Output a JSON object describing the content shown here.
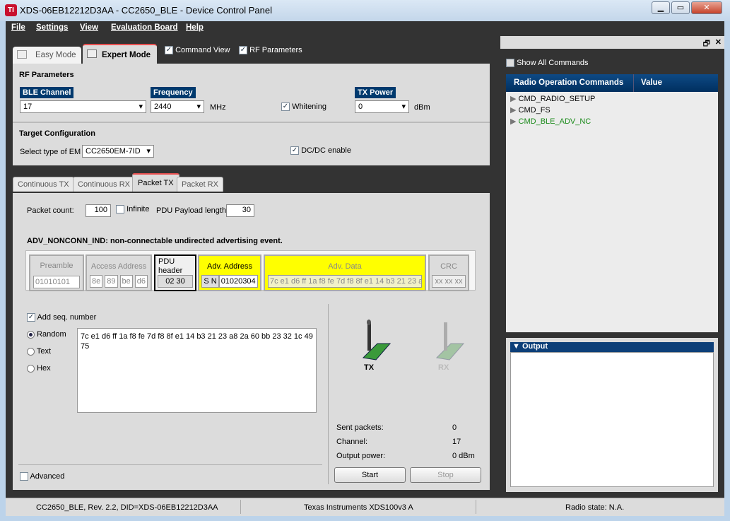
{
  "window": {
    "title": "XDS-06EB12212D3AA - CC2650_BLE - Device Control Panel",
    "logo": "TI",
    "min": "▁",
    "max": "▭",
    "close": "✕"
  },
  "menu": [
    "File",
    "Settings",
    "View",
    "Evaluation Board",
    "Help"
  ],
  "mode_tabs": {
    "easy": "Easy Mode",
    "expert": "Expert Mode"
  },
  "view_opts": {
    "command_view": "Command View",
    "rf_parameters": "RF Parameters"
  },
  "rf": {
    "title": "RF Parameters",
    "ble_channel_label": "BLE Channel",
    "ble_channel": "17",
    "frequency_label": "Frequency",
    "frequency": "2440",
    "mhz": "MHz",
    "whitening": "Whitening",
    "tx_power_label": "TX Power",
    "tx_power": "0",
    "dbm": "dBm"
  },
  "target": {
    "title": "Target Configuration",
    "em_label": "Select type of EM",
    "em": "CC2650EM-7ID",
    "dcdc": "DC/DC enable"
  },
  "tabs": [
    "Continuous TX",
    "Continuous RX",
    "Packet TX",
    "Packet RX"
  ],
  "packet": {
    "count_label": "Packet count:",
    "count": "100",
    "infinite": "Infinite",
    "payload_label": "PDU Payload length:",
    "payload": "30",
    "event": "ADV_NONCONN_IND: non-connectable undirected advertising event.",
    "preamble_label": "Preamble",
    "preamble": "01010101",
    "access_label": "Access Address",
    "access": [
      "8e",
      "89",
      "be",
      "d6"
    ],
    "pdu_label": "PDU header",
    "pdu": "02 30",
    "adv_addr_label": "Adv. Address",
    "sn": "S N",
    "adv_addr": "01020304",
    "adv_data_label": "Adv. Data",
    "adv_data": "7c e1 d6 ff 1a f8 fe 7d f8 8f e1 14 b3 21 23 a",
    "crc_label": "CRC",
    "crc": "xx xx xx",
    "add_seq": "Add seq. number",
    "random": "Random",
    "text": "Text",
    "hex": "Hex",
    "data_text": "7c e1 d6 ff 1a f8 fe 7d f8 8f e1 14 b3 21 23 a8 2a 60 bb 23 32 1c 49 75",
    "advanced": "Advanced",
    "tx": "TX",
    "rx": "RX",
    "sent_label": "Sent packets:",
    "sent": "0",
    "channel_label": "Channel:",
    "channel": "17",
    "power_label": "Output power:",
    "power": "0 dBm",
    "start": "Start",
    "stop": "Stop"
  },
  "commands": {
    "show_all": "Show All Commands",
    "col1": "Radio Operation Commands",
    "col2": "Value",
    "items": [
      "CMD_RADIO_SETUP",
      "CMD_FS",
      "CMD_BLE_ADV_NC"
    ],
    "restore": "🗗",
    "close": "✕"
  },
  "output": {
    "title": "Output"
  },
  "status": {
    "left": "CC2650_BLE, Rev. 2.2, DID=XDS-06EB12212D3AA",
    "mid": "Texas Instruments XDS100v3 A",
    "right": "Radio state: N.A."
  }
}
